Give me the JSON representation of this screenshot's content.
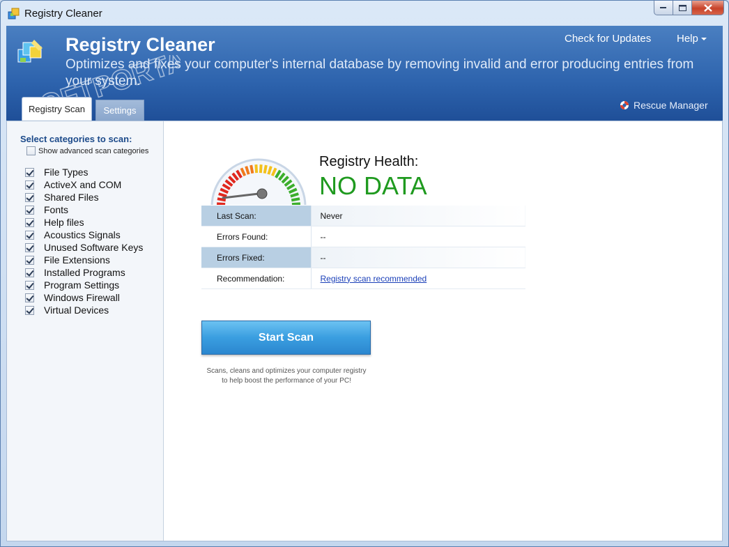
{
  "window": {
    "title": "Registry Cleaner"
  },
  "header": {
    "app_name": "Registry Cleaner",
    "tagline": "Optimizes and fixes your computer's internal database by removing invalid and error producing entries from your system.",
    "check_updates": "Check for Updates",
    "help": "Help",
    "rescue_manager": "Rescue Manager",
    "watermark": "SOFTPORTAL"
  },
  "tabs": [
    {
      "label": "Registry Scan",
      "active": true
    },
    {
      "label": "Settings",
      "active": false
    }
  ],
  "sidebar": {
    "title": "Select categories to scan:",
    "advanced": {
      "label": "Show advanced scan categories",
      "checked": false
    },
    "categories": [
      {
        "label": "File Types",
        "checked": true
      },
      {
        "label": "ActiveX and COM",
        "checked": true
      },
      {
        "label": "Shared Files",
        "checked": true
      },
      {
        "label": "Fonts",
        "checked": true
      },
      {
        "label": "Help files",
        "checked": true
      },
      {
        "label": "Acoustics Signals",
        "checked": true
      },
      {
        "label": "Unused Software Keys",
        "checked": true
      },
      {
        "label": "File Extensions",
        "checked": true
      },
      {
        "label": "Installed Programs",
        "checked": true
      },
      {
        "label": "Program Settings",
        "checked": true
      },
      {
        "label": "Windows Firewall",
        "checked": true
      },
      {
        "label": "Virtual Devices",
        "checked": true
      }
    ]
  },
  "health": {
    "label": "Registry Health:",
    "value": "NO DATA",
    "value_color": "#1f9a1f"
  },
  "info": {
    "last_scan_label": "Last Scan:",
    "last_scan_value": "Never",
    "errors_found_label": "Errors Found:",
    "errors_found_value": "--",
    "errors_fixed_label": "Errors Fixed:",
    "errors_fixed_value": "--",
    "recommendation_label": "Recommendation:",
    "recommendation_value": "Registry scan recommended"
  },
  "scan": {
    "button_label": "Start Scan",
    "description_line1": "Scans, cleans and optimizes your computer registry",
    "description_line2": "to help boost the performance of your PC!"
  },
  "colors": {
    "accent": "#2d63ad",
    "button": "#3a9ee0",
    "link": "#1a3fb8"
  }
}
